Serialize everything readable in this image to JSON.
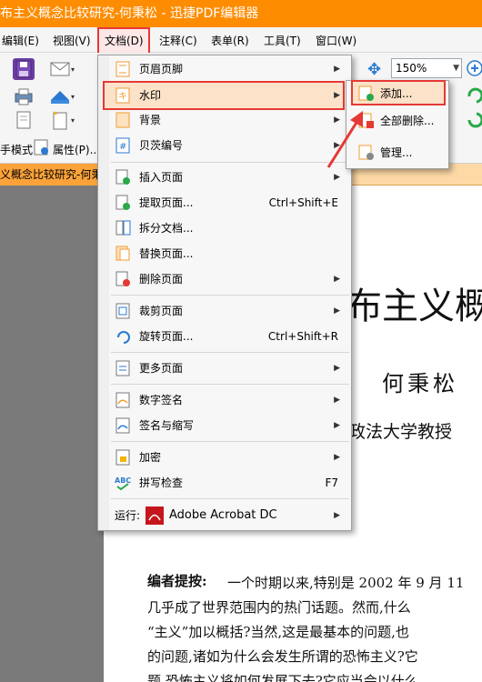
{
  "window": {
    "title": "布主义概念比较研究-何秉松  - 迅捷PDF编辑器"
  },
  "menubar": {
    "items": [
      "编辑(E)",
      "视图(V)",
      "文档(D)",
      "注释(C)",
      "表单(R)",
      "工具(T)",
      "窗口(W)"
    ]
  },
  "toolbar": {
    "zoom": "150%",
    "mode_label": "手模式",
    "properties_label": "属性(P)..."
  },
  "tab": {
    "label": "义概念比较研究-何秉松"
  },
  "document_menu": {
    "items": [
      {
        "label": "页眉页脚",
        "shortcut": "",
        "submenu": true
      },
      {
        "label": "水印",
        "shortcut": "",
        "submenu": true
      },
      {
        "label": "背景",
        "shortcut": "",
        "submenu": true
      },
      {
        "label": "贝茨编号",
        "shortcut": "",
        "submenu": true
      },
      {
        "label": "插入页面",
        "shortcut": "",
        "submenu": true
      },
      {
        "label": "提取页面...",
        "shortcut": "Ctrl+Shift+E",
        "submenu": false
      },
      {
        "label": "拆分文档...",
        "shortcut": "",
        "submenu": false
      },
      {
        "label": "替换页面...",
        "shortcut": "",
        "submenu": false
      },
      {
        "label": "删除页面",
        "shortcut": "",
        "submenu": true
      },
      {
        "label": "裁剪页面",
        "shortcut": "",
        "submenu": true
      },
      {
        "label": "旋转页面...",
        "shortcut": "Ctrl+Shift+R",
        "submenu": false
      },
      {
        "label": "更多页面",
        "shortcut": "",
        "submenu": true
      },
      {
        "label": "数字签名",
        "shortcut": "",
        "submenu": true
      },
      {
        "label": "签名与缩写",
        "shortcut": "",
        "submenu": true
      },
      {
        "label": "加密",
        "shortcut": "",
        "submenu": true
      },
      {
        "label": "拼写检查",
        "shortcut": "F7",
        "submenu": false
      }
    ],
    "run_label": "运行:",
    "run_app": "Adobe Acrobat DC"
  },
  "watermark_submenu": {
    "items": [
      "添加...",
      "全部删除...",
      "管理..."
    ]
  },
  "page": {
    "heading": "布主义概",
    "author": "何秉松",
    "affiliation": "政法大学教授",
    "abstract_label": "编者提按:",
    "abstract_lines": [
      "一个时期以来,特别是 2002 年 9 月 11",
      "几乎成了世界范围内的热门话题。然而,什么",
      "“主义”加以概括?当然,这是最基本的问题,也",
      "的问题,诸如为什么会发生所谓的恐怖主义?它",
      "题,恐怖主义将如何发展下去?它应当会以什么"
    ]
  },
  "colors": {
    "title_orange": "#fe8c00",
    "highlight_red": "#e53935",
    "menu_highlight": "#fbe2c8"
  }
}
